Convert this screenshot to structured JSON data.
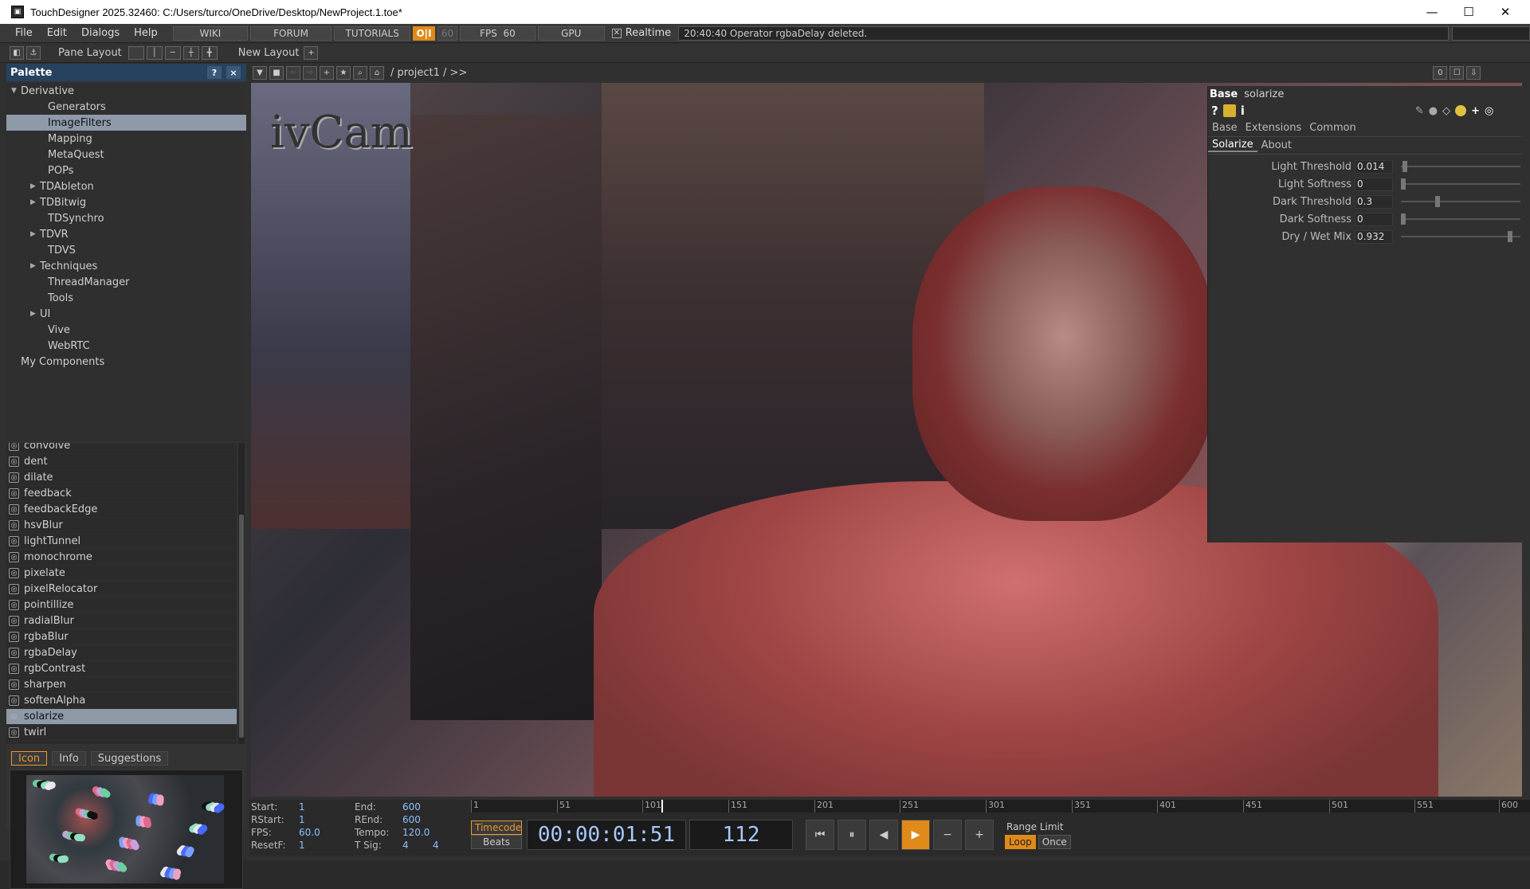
{
  "window": {
    "title": "TouchDesigner 2025.32460: C:/Users/turco/OneDrive/Desktop/NewProject.1.toe*"
  },
  "menu": {
    "items": [
      "File",
      "Edit",
      "Dialogs",
      "Help"
    ],
    "wiki": "WIKI",
    "forum": "FORUM",
    "tutorials": "TUTORIALS",
    "oi": "O|I",
    "fps_box": "60",
    "fps_label": "FPS",
    "fps_value": "60",
    "gpu": "GPU",
    "realtime": "Realtime",
    "message": "20:40:40 Operator rgbaDelay deleted."
  },
  "toolbar": {
    "pane_layout": "Pane Layout",
    "new_layout": "New Layout"
  },
  "palette": {
    "title": "Palette",
    "help": "?",
    "close": "×",
    "tree": [
      {
        "label": "Derivative",
        "level": 0,
        "expander": "▼"
      },
      {
        "label": "Generators",
        "level": 1,
        "expander": ""
      },
      {
        "label": "ImageFilters",
        "level": 1,
        "expander": "",
        "selected": true
      },
      {
        "label": "Mapping",
        "level": 1,
        "expander": ""
      },
      {
        "label": "MetaQuest",
        "level": 1,
        "expander": ""
      },
      {
        "label": "POPs",
        "level": 1,
        "expander": ""
      },
      {
        "label": "TDAbleton",
        "level": 1,
        "expander": "▶"
      },
      {
        "label": "TDBitwig",
        "level": 1,
        "expander": "▶"
      },
      {
        "label": "TDSynchro",
        "level": 1,
        "expander": ""
      },
      {
        "label": "TDVR",
        "level": 1,
        "expander": "▶"
      },
      {
        "label": "TDVS",
        "level": 1,
        "expander": ""
      },
      {
        "label": "Techniques",
        "level": 1,
        "expander": "▶"
      },
      {
        "label": "ThreadManager",
        "level": 1,
        "expander": ""
      },
      {
        "label": "Tools",
        "level": 1,
        "expander": ""
      },
      {
        "label": "UI",
        "level": 1,
        "expander": "▶"
      },
      {
        "label": "Vive",
        "level": 1,
        "expander": ""
      },
      {
        "label": "WebRTC",
        "level": 1,
        "expander": ""
      },
      {
        "label": "My Components",
        "level": 0,
        "expander": ""
      }
    ],
    "ops": [
      "convolve",
      "dent",
      "dilate",
      "feedback",
      "feedbackEdge",
      "hsvBlur",
      "lightTunnel",
      "monochrome",
      "pixelate",
      "pixelRelocator",
      "pointillize",
      "radialBlur",
      "rgbaBlur",
      "rgbaDelay",
      "rgbContrast",
      "sharpen",
      "softenAlpha",
      "solarize",
      "twirl"
    ],
    "selected_op": "solarize",
    "tabs": [
      "Icon",
      "Info",
      "Suggestions"
    ]
  },
  "network": {
    "path": "/ project1 / >>",
    "counter": "0"
  },
  "viewport": {
    "watermark": "ivCam"
  },
  "params": {
    "type": "Base",
    "name": "solarize",
    "pages": [
      "Base",
      "Extensions",
      "Common"
    ],
    "subpages": [
      "Solarize",
      "About"
    ],
    "rows": [
      {
        "label": "Light Threshold",
        "value": "0.014",
        "level": 0.014
      },
      {
        "label": "Light Softness",
        "value": "0",
        "level": 0
      },
      {
        "label": "Dark Threshold",
        "value": "0.3",
        "level": 0.3
      },
      {
        "label": "Dark Softness",
        "value": "0",
        "level": 0
      },
      {
        "label": "Dry / Wet Mix",
        "value": "0.932",
        "level": 0.932
      }
    ]
  },
  "timeline": {
    "start_l": "Start:",
    "start": "1",
    "rstart_l": "RStart:",
    "rstart": "1",
    "fps_l": "FPS:",
    "fps": "60.0",
    "resetf_l": "ResetF:",
    "resetf": "1",
    "end_l": "End:",
    "end": "600",
    "rend_l": "REnd:",
    "rend": "600",
    "tempo_l": "Tempo:",
    "tempo": "120.0",
    "tsig_l": "T Sig:",
    "tsig_a": "4",
    "tsig_b": "4",
    "ticks": [
      "1",
      "51",
      "101",
      "151",
      "201",
      "251",
      "301",
      "351",
      "401",
      "451",
      "501",
      "551",
      "600"
    ],
    "current_frame_num": 112,
    "timecode_btn": "Timecode",
    "beats_btn": "Beats",
    "timecode": "00:00:01:51",
    "frame": "112",
    "range_limit": "Range Limit",
    "loop": "Loop",
    "once": "Once"
  }
}
